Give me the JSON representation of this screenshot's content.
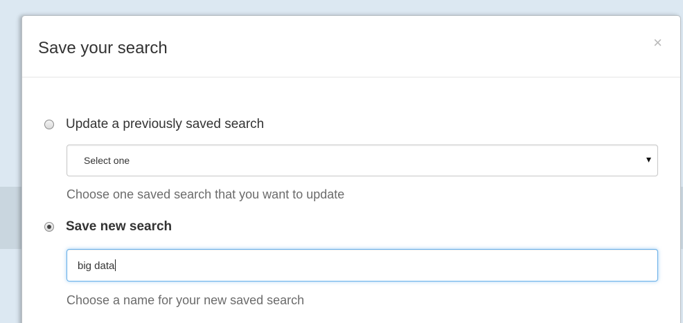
{
  "modal": {
    "title": "Save your search",
    "close_label": "×"
  },
  "update_option": {
    "label": "Update a previously saved search",
    "checked": false,
    "select": {
      "selected": "Select one",
      "caret": "▾"
    },
    "help": "Choose one saved search that you want to update"
  },
  "new_option": {
    "label": "Save new search",
    "checked": true,
    "input_value": "big data",
    "help": "Choose a name for your new saved search"
  }
}
